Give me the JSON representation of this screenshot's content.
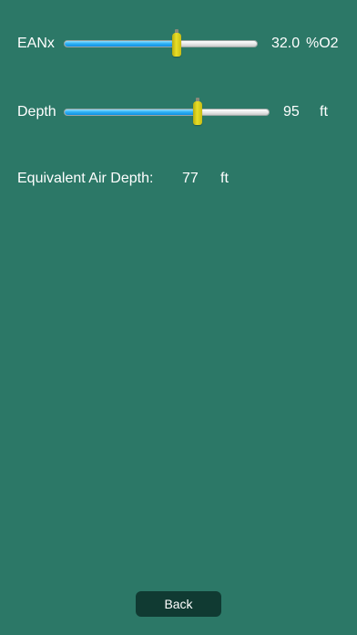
{
  "eanx": {
    "label": "EANx",
    "value": "32.0",
    "unit": "%O2",
    "slider_fraction": 0.58
  },
  "depth": {
    "label": "Depth",
    "value": "95",
    "unit": "ft",
    "slider_fraction": 0.65
  },
  "ead": {
    "label": "Equivalent Air Depth:",
    "value": "77",
    "unit": "ft"
  },
  "back_button": {
    "label": "Back"
  },
  "colors": {
    "background": "#2c7867",
    "slider_fill": "#2fb2f5",
    "thumb": "#e8de27",
    "button": "#103a32"
  }
}
